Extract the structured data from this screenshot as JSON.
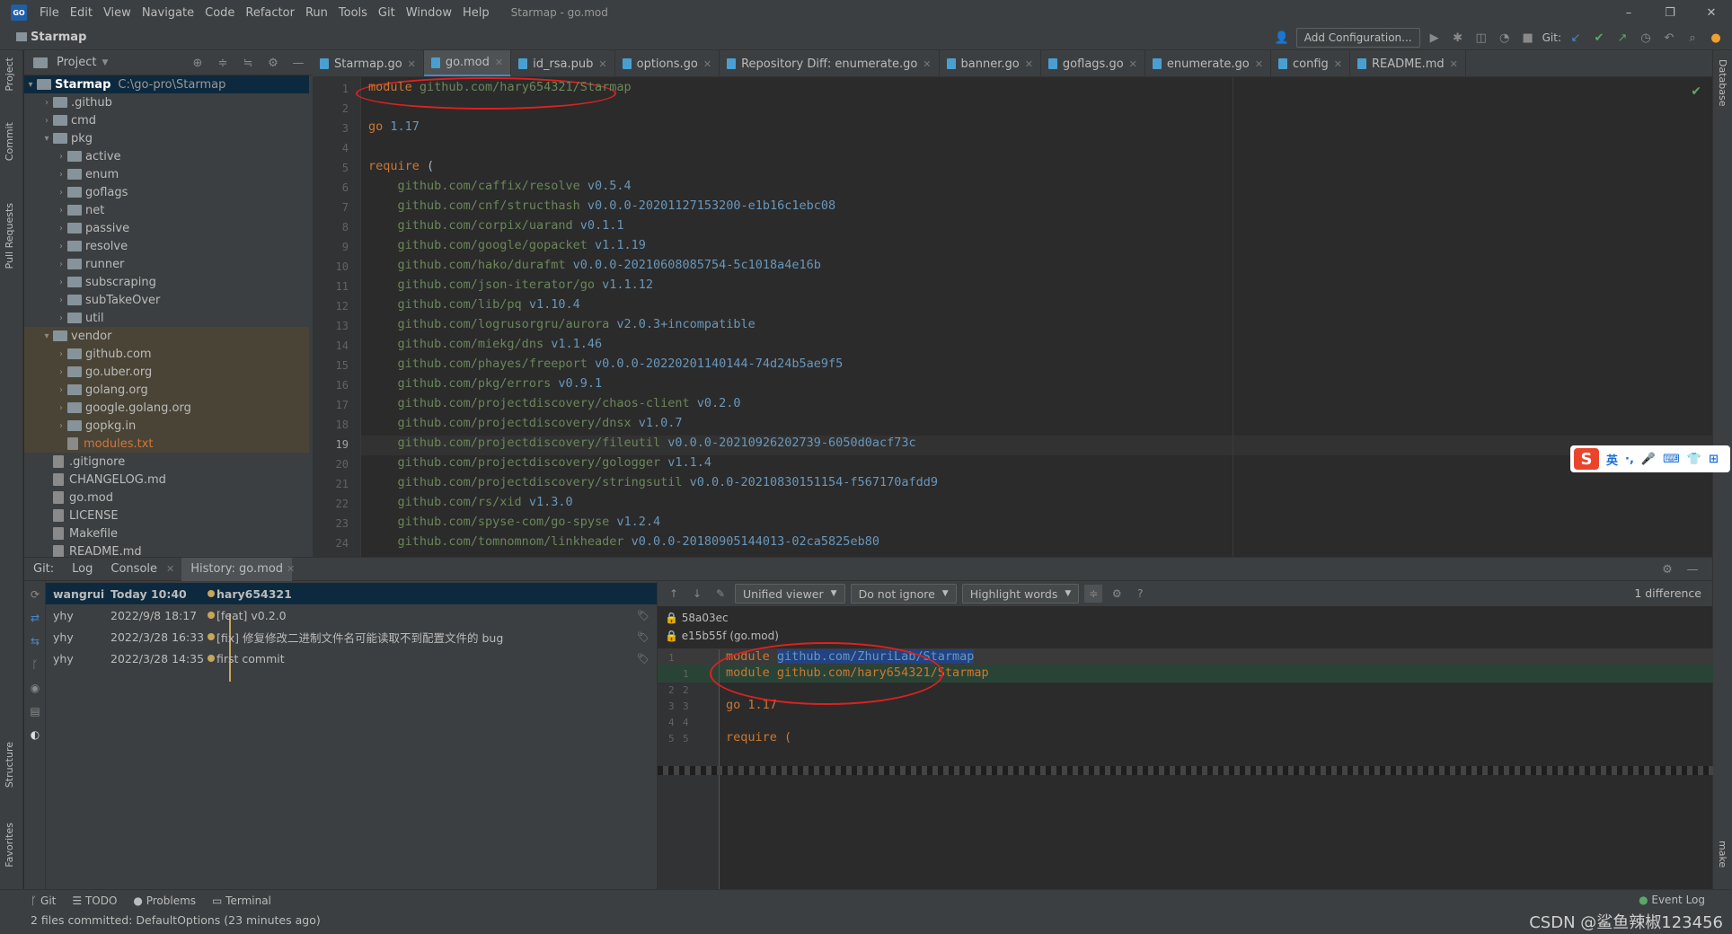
{
  "window": {
    "title": "Starmap - go.mod",
    "menu": [
      "File",
      "Edit",
      "View",
      "Navigate",
      "Code",
      "Refactor",
      "Run",
      "Tools",
      "Git",
      "Window",
      "Help"
    ],
    "controls": [
      "–",
      "❐",
      "✕"
    ]
  },
  "navbar": {
    "project": "Starmap",
    "add_config": "Add Configuration...",
    "git_label": "Git:"
  },
  "side_tabs": {
    "left": [
      "Project",
      "Commit",
      "Pull Requests",
      "Structure",
      "Favorites"
    ],
    "right": [
      "Database",
      "make"
    ]
  },
  "project_panel": {
    "title": "Project",
    "root_name": "Starmap",
    "root_path": "C:\\go-pro\\Starmap",
    "items": [
      {
        "name": ".github",
        "level": 1,
        "type": "folder"
      },
      {
        "name": "cmd",
        "level": 1,
        "type": "folder"
      },
      {
        "name": "pkg",
        "level": 1,
        "type": "folder",
        "open": true
      },
      {
        "name": "active",
        "level": 2,
        "type": "folder"
      },
      {
        "name": "enum",
        "level": 2,
        "type": "folder"
      },
      {
        "name": "goflags",
        "level": 2,
        "type": "folder"
      },
      {
        "name": "net",
        "level": 2,
        "type": "folder"
      },
      {
        "name": "passive",
        "level": 2,
        "type": "folder"
      },
      {
        "name": "resolve",
        "level": 2,
        "type": "folder"
      },
      {
        "name": "runner",
        "level": 2,
        "type": "folder"
      },
      {
        "name": "subscraping",
        "level": 2,
        "type": "folder"
      },
      {
        "name": "subTakeOver",
        "level": 2,
        "type": "folder"
      },
      {
        "name": "util",
        "level": 2,
        "type": "folder"
      },
      {
        "name": "vendor",
        "level": 1,
        "type": "folder",
        "open": true
      },
      {
        "name": "github.com",
        "level": 2,
        "type": "folder"
      },
      {
        "name": "go.uber.org",
        "level": 2,
        "type": "folder"
      },
      {
        "name": "golang.org",
        "level": 2,
        "type": "folder"
      },
      {
        "name": "google.golang.org",
        "level": 2,
        "type": "folder"
      },
      {
        "name": "gopkg.in",
        "level": 2,
        "type": "folder"
      },
      {
        "name": "modules.txt",
        "level": 2,
        "type": "file"
      },
      {
        "name": ".gitignore",
        "level": 1,
        "type": "file"
      },
      {
        "name": "CHANGELOG.md",
        "level": 1,
        "type": "file"
      },
      {
        "name": "go.mod",
        "level": 1,
        "type": "file"
      },
      {
        "name": "LICENSE",
        "level": 1,
        "type": "file"
      },
      {
        "name": "Makefile",
        "level": 1,
        "type": "file"
      },
      {
        "name": "README.md",
        "level": 1,
        "type": "file"
      }
    ]
  },
  "editor_tabs": [
    "Starmap.go",
    "go.mod",
    "id_rsa.pub",
    "options.go",
    "Repository Diff: enumerate.go",
    "banner.go",
    "goflags.go",
    "enumerate.go",
    "config",
    "README.md"
  ],
  "editor": {
    "lines": [
      "module github.com/hary654321/Starmap",
      "",
      "go 1.17",
      "",
      "require (",
      "    github.com/caffix/resolve v0.5.4",
      "    github.com/cnf/structhash v0.0.0-20201127153200-e1b16c1ebc08",
      "    github.com/corpix/uarand v0.1.1",
      "    github.com/google/gopacket v1.1.19",
      "    github.com/hako/durafmt v0.0.0-20210608085754-5c1018a4e16b",
      "    github.com/json-iterator/go v1.1.12",
      "    github.com/lib/pq v1.10.4",
      "    github.com/logrusorgru/aurora v2.0.3+incompatible",
      "    github.com/miekg/dns v1.1.46",
      "    github.com/phayes/freeport v0.0.0-20220201140144-74d24b5ae9f5",
      "    github.com/pkg/errors v0.9.1",
      "    github.com/projectdiscovery/chaos-client v0.2.0",
      "    github.com/projectdiscovery/dnsx v1.0.7",
      "    github.com/projectdiscovery/fileutil v0.0.0-20210926202739-6050d0acf73c",
      "    github.com/projectdiscovery/gologger v1.1.4",
      "    github.com/projectdiscovery/stringsutil v0.0.0-20210830151154-f567170afdd9",
      "    github.com/rs/xid v1.3.0",
      "    github.com/spyse-com/go-spyse v1.2.4",
      "    github.com/tomnomnom/linkheader v0.0.0-20180905144013-02ca5825eb80"
    ],
    "current_line": 19
  },
  "bottom": {
    "tabs": [
      "Git:",
      "Log",
      "Console",
      "History: go.mod"
    ],
    "history": [
      {
        "author": "wangrui",
        "date": "Today 10:40",
        "message": "hary654321"
      },
      {
        "author": "yhy",
        "date": "2022/9/8 18:17",
        "message": "[feat] v0.2.0"
      },
      {
        "author": "yhy",
        "date": "2022/3/28 16:33",
        "message": "[fix] 修复修改二进制文件名可能读取不到配置文件的 bug"
      },
      {
        "author": "yhy",
        "date": "2022/3/28 14:35",
        "message": "first commit"
      }
    ],
    "diff": {
      "viewer": "Unified viewer",
      "ignore": "Do not ignore",
      "highlight": "Highlight words",
      "count": "1 difference",
      "help": "?",
      "hash_left": "58a03ec",
      "hash_right": "e15b55f (go.mod)",
      "lines": [
        {
          "l": "1",
          "r": "",
          "kind": "del",
          "pre": "module ",
          "hl": "github.com/ZhuriLab/Starmap"
        },
        {
          "l": "",
          "r": "1",
          "kind": "add",
          "pre": "module github.com/hary654321/Starmap",
          "hl": ""
        },
        {
          "l": "2",
          "r": "2",
          "kind": "ctx",
          "pre": "",
          "hl": ""
        },
        {
          "l": "3",
          "r": "3",
          "kind": "ctx",
          "pre": "go 1.17",
          "hl": ""
        },
        {
          "l": "4",
          "r": "4",
          "kind": "ctx",
          "pre": "",
          "hl": ""
        },
        {
          "l": "5",
          "r": "5",
          "kind": "ctx",
          "pre": "require (",
          "hl": ""
        }
      ]
    }
  },
  "status": {
    "tool_tabs": [
      "Git",
      "TODO",
      "Problems",
      "Terminal"
    ],
    "message": "2 files committed: DefaultOptions (23 minutes ago)",
    "event_log": "Event Log",
    "watermark": "CSDN @鲨鱼辣椒123456"
  },
  "ime": {
    "items": [
      "英",
      "·,",
      "🎤",
      "⌨",
      "👕",
      "⊞"
    ]
  }
}
